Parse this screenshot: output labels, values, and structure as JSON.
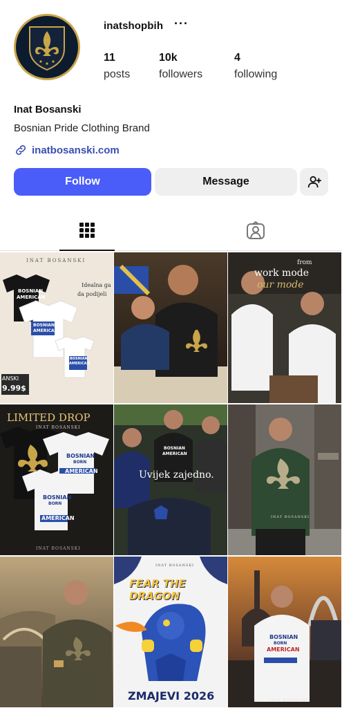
{
  "profile": {
    "username": "inatshopbih",
    "more_label": "···",
    "stats": {
      "posts_count": "11",
      "posts_label": "posts",
      "followers_count": "10k",
      "followers_label": "followers",
      "following_count": "4",
      "following_label": "following"
    },
    "display_name": "Inat Bosanski",
    "bio": "Bosnian Pride Clothing Brand",
    "link": "inatbosanski.com"
  },
  "actions": {
    "follow_label": "Follow",
    "message_label": "Message"
  },
  "icons": {
    "more": "more-icon",
    "link": "link-icon",
    "add_user": "add-user-icon",
    "grid": "grid-icon",
    "tagged": "tagged-icon"
  },
  "posts": [
    {
      "texts": [
        "INAT BOSANSKI",
        "Idealna ga",
        "da podijeli",
        "ANSKI",
        "9.99$",
        "BOSNIAN",
        "AMERICAN",
        "BOSNIAN",
        "AMERICAN",
        "BOSNIAN",
        "AMERICAN"
      ]
    },
    {
      "texts": []
    },
    {
      "texts": [
        "from",
        "work mode",
        "our mode"
      ]
    },
    {
      "texts": [
        "LIMITED DROP",
        "INAT BOSANSKI",
        "BOSNIAN",
        "BORN",
        "AMERICAN",
        "BOSNIAN",
        "BORN",
        "AMERICAN",
        "INAT BOSANSKI"
      ]
    },
    {
      "texts": [
        "Uvijek zajedno.",
        "BOSNIAN",
        "AMERICAN"
      ]
    },
    {
      "texts": [
        "INAT BOSANSKI"
      ]
    },
    {
      "texts": []
    },
    {
      "texts": [
        "FEAR THE DRAGON",
        "ZMAJEVI 2026",
        "INAT BOSANSKI"
      ]
    },
    {
      "texts": [
        "BOSNIAN",
        "BORN",
        "AMERICAN",
        "INAT BOSANSKI"
      ]
    }
  ],
  "colors": {
    "accent": "#4a5df9",
    "link": "#3a4fb0",
    "avatar_bg": "#0d1b2e",
    "gold": "#c9a54a"
  }
}
